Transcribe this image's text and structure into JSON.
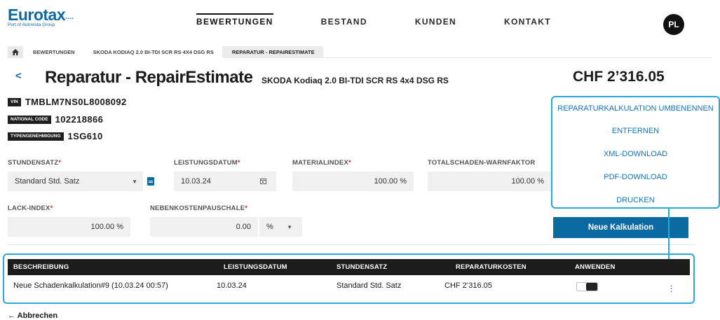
{
  "logo": {
    "name": "Eurotax",
    "dots": "....",
    "tagline": "Port of Autovista Group"
  },
  "nav": {
    "items": [
      "BEWERTUNGEN",
      "BESTAND",
      "KUNDEN",
      "KONTAKT"
    ],
    "active": "BEWERTUNGEN"
  },
  "user": {
    "initials": "PL"
  },
  "breadcrumb": {
    "home_icon": "home-icon",
    "items": [
      "BEWERTUNGEN",
      "SKODA KODIAQ 2.0 BI-TDI SCR RS 4X4 DSG RS",
      "REPARATUR - REPAIRESTIMATE"
    ]
  },
  "header": {
    "back_label": "<",
    "title": "Reparatur - RepairEstimate",
    "subtitle": "SKODA Kodiaq 2.0 BI-TDI SCR RS 4x4 DSG RS",
    "total": "CHF 2’316.05"
  },
  "vehicle": {
    "vin_label": "VIN",
    "vin": "TMBLM7NS0L8008092",
    "national_code_label": "NATIONAL CODE",
    "national_code": "102218866",
    "type_label": "TYPENGENEHMIGUNG",
    "type_approval": "1SG610"
  },
  "form": {
    "stundensatz_label": "STUNDENSATZ",
    "stundensatz_value": "Standard Std. Satz",
    "leistungsdatum_label": "LEISTUNGSDATUM",
    "leistungsdatum_value": "10.03.24",
    "materialindex_label": "MATERIALINDEX",
    "materialindex_value": "100.00 %",
    "totalschaden_label": "TOTALSCHADEN-WARNFAKTOR",
    "totalschaden_value": "100.00 %",
    "lackindex_label": "LACK-INDEX",
    "lackindex_value": "100.00 %",
    "nebenkosten_label": "NEBENKOSTENPAUSCHALE",
    "nebenkosten_value": "0.00",
    "nebenkosten_unit": "%",
    "required_mark": "*"
  },
  "menu": {
    "items": [
      "REPARATURKALKULATION UMBENENNEN",
      "ENTFERNEN",
      "XML-DOWNLOAD",
      "PDF-DOWNLOAD",
      "DRUCKEN"
    ]
  },
  "new_calc_button": "Neue Kalkulation",
  "table": {
    "headers": [
      "BESCHREIBUNG",
      "LEISTUNGSDATUM",
      "STUNDENSATZ",
      "REPARATURKOSTEN",
      "ANWENDEN"
    ],
    "rows": [
      {
        "beschreibung": "Neue Schadenkalkulation#9 (10.03.24 00:57)",
        "leistungsdatum": "10.03.24",
        "stundensatz": "Standard Std. Satz",
        "reparaturkosten": "CHF 2’316.05",
        "anwenden": true
      }
    ]
  },
  "footer": {
    "cancel_label": "← Abbrechen"
  },
  "colors": {
    "brand": "#0c6aa3",
    "highlight": "#28a9d9",
    "required": "#d52b1e"
  }
}
